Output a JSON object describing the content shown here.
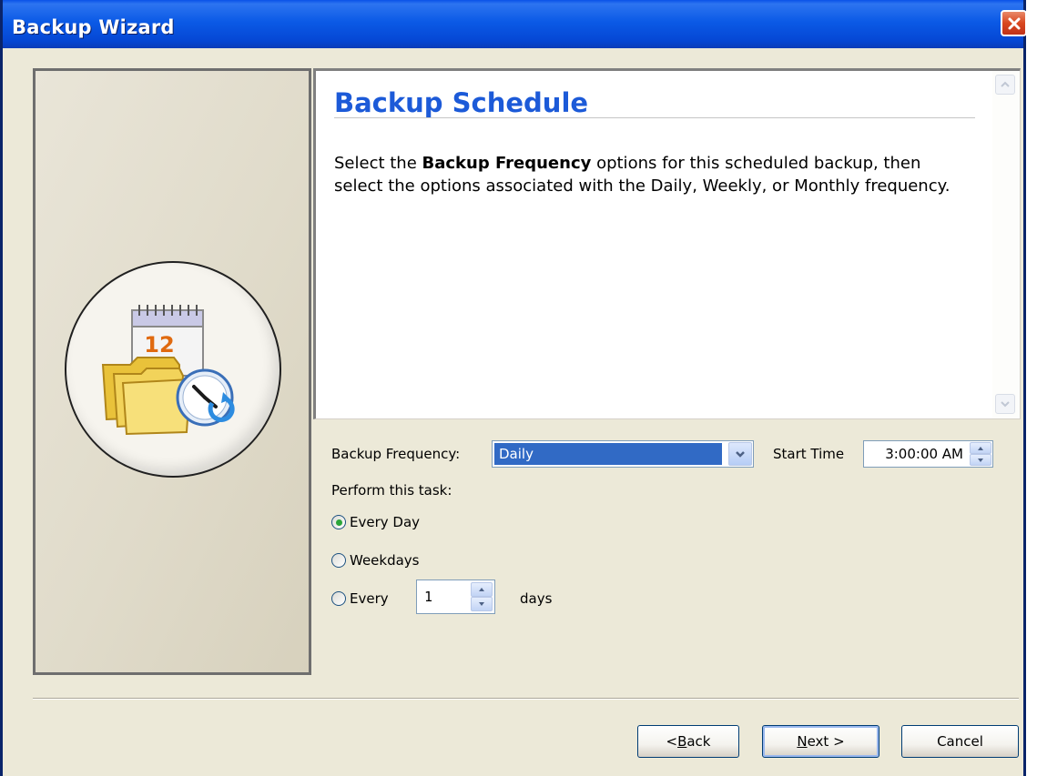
{
  "window": {
    "title": "Backup Wizard",
    "colors": {
      "titlebar": "#0b5ae6",
      "heading": "#1c5ad8",
      "selection": "#316ac5",
      "close": "#d9471f"
    }
  },
  "header": {
    "title": "Backup Schedule",
    "description_prefix": "Select the ",
    "description_bold": "Backup Frequency",
    "description_suffix": " options for this scheduled backup, then select the options associated with the Daily, Weekly, or Monthly frequency."
  },
  "icons": {
    "wizard_image": "calendar-folders-clock-icon",
    "calendar_day": "12",
    "close": "close-icon",
    "scroll_up": "scroll-up-arrow-icon",
    "scroll_down": "scroll-down-arrow-icon"
  },
  "schedule": {
    "frequency_label": "Backup Frequency:",
    "frequency_value": "Daily",
    "start_time_label": "Start Time",
    "start_time_value": "3:00:00 AM",
    "perform_label": "Perform this task:",
    "options": [
      {
        "label": "Every Day",
        "selected": true
      },
      {
        "label": "Weekdays",
        "selected": false
      },
      {
        "label": "Every",
        "selected": false
      }
    ],
    "every_n_value": "1",
    "days_label": "days"
  },
  "buttons": {
    "back_prefix": "< ",
    "back_mnemonic": "B",
    "back_rest": "ack",
    "next_mnemonic": "N",
    "next_rest": "ext >",
    "cancel": "Cancel"
  }
}
